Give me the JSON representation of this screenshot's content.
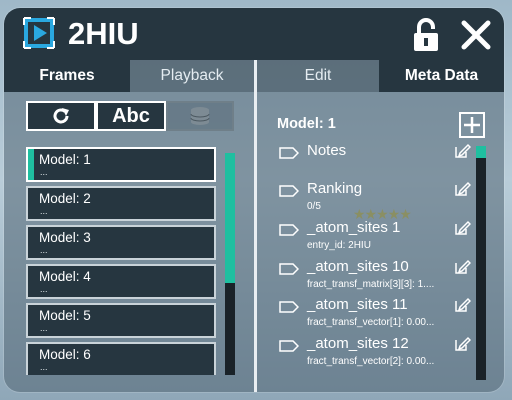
{
  "window": {
    "title": "2HIU",
    "app_icon": "protein-viewer-icon",
    "lock_icon": "unlocked-padlock-icon",
    "close_icon": "close-x-icon"
  },
  "tabs_left": [
    "Frames",
    "Playback"
  ],
  "tabs_right": [
    "Edit",
    "Meta Data"
  ],
  "toolbar": {
    "refresh_icon": "refresh-icon",
    "abc_label": "Abc",
    "database_icon": "database-icon"
  },
  "frames": [
    {
      "label": "Model: 1",
      "sub": "..."
    },
    {
      "label": "Model: 2",
      "sub": "..."
    },
    {
      "label": "Model: 3",
      "sub": "..."
    },
    {
      "label": "Model: 4",
      "sub": "..."
    },
    {
      "label": "Model: 5",
      "sub": "..."
    },
    {
      "label": "Model: 6",
      "sub": "..."
    }
  ],
  "meta": {
    "model_label": "Model: 1",
    "add_icon": "plus-icon",
    "rows": [
      {
        "label": "Notes",
        "value": ""
      },
      {
        "label": "Ranking",
        "value": "0/5",
        "stars": "★★★★★"
      },
      {
        "label": "_atom_sites 1",
        "value": "entry_id: 2HIU"
      },
      {
        "label": "_atom_sites 10",
        "value": "fract_transf_matrix[3][3]: 1...."
      },
      {
        "label": "_atom_sites 11",
        "value": "fract_transf_vector[1]: 0.00..."
      },
      {
        "label": "_atom_sites 12",
        "value": "fract_transf_vector[2]: 0.00..."
      }
    ]
  },
  "colors": {
    "accent": "#1fbfa0",
    "header_bg": "#263640",
    "panel_bg": "#263640"
  }
}
